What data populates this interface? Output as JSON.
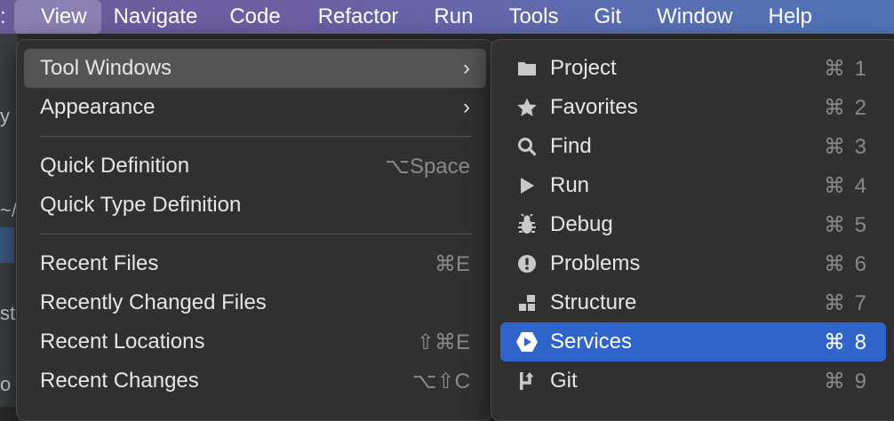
{
  "menubar": {
    "items": [
      "View",
      "Navigate",
      "Code",
      "Refactor",
      "Run",
      "Tools",
      "Git",
      "Window",
      "Help"
    ],
    "active_index": 0,
    "left_fragment": ":"
  },
  "background": {
    "fragments": [
      "y",
      "~/",
      "st",
      "o"
    ]
  },
  "view_menu": {
    "items": [
      {
        "label": "Tool Windows",
        "shortcut": "",
        "submenu": true
      },
      {
        "label": "Appearance",
        "shortcut": "",
        "submenu": true
      },
      {
        "label": "Quick Definition",
        "shortcut": "⌥Space",
        "submenu": false
      },
      {
        "label": "Quick Type Definition",
        "shortcut": "",
        "submenu": false
      },
      {
        "label": "Recent Files",
        "shortcut": "⌘E",
        "submenu": false
      },
      {
        "label": "Recently Changed Files",
        "shortcut": "",
        "submenu": false
      },
      {
        "label": "Recent Locations",
        "shortcut": "⇧⌘E",
        "submenu": false
      },
      {
        "label": "Recent Changes",
        "shortcut": "⌥⇧C",
        "submenu": false
      }
    ],
    "chevron": "›"
  },
  "tool_windows": {
    "items": [
      {
        "label": "Project",
        "shortcut": "⌘ 1",
        "icon": "folder-icon"
      },
      {
        "label": "Favorites",
        "shortcut": "⌘ 2",
        "icon": "star-icon"
      },
      {
        "label": "Find",
        "shortcut": "⌘ 3",
        "icon": "search-icon"
      },
      {
        "label": "Run",
        "shortcut": "⌘ 4",
        "icon": "play-icon"
      },
      {
        "label": "Debug",
        "shortcut": "⌘ 5",
        "icon": "bug-icon"
      },
      {
        "label": "Problems",
        "shortcut": "⌘ 6",
        "icon": "alert-icon"
      },
      {
        "label": "Structure",
        "shortcut": "⌘ 7",
        "icon": "structure-icon"
      },
      {
        "label": "Services",
        "shortcut": "⌘ 8",
        "icon": "services-icon"
      },
      {
        "label": "Git",
        "shortcut": "⌘ 9",
        "icon": "git-icon"
      }
    ],
    "selected_index": 7
  },
  "colors": {
    "selection": "#2f65ca",
    "menu_bg": "#303030",
    "hover": "#545454"
  }
}
